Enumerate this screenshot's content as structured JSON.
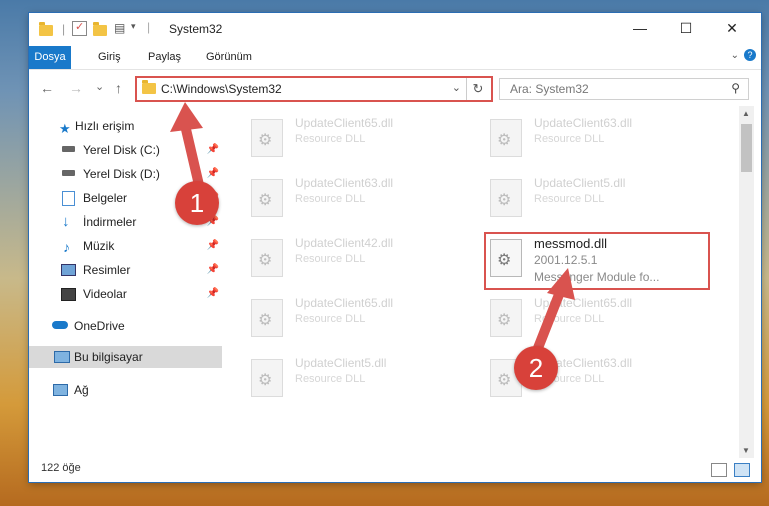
{
  "window": {
    "title": "System32",
    "minimize": "—",
    "maximize": "☐",
    "close": "✕"
  },
  "ribbon": {
    "tabs": [
      "Dosya",
      "Giriş",
      "Paylaş",
      "Görünüm"
    ]
  },
  "address": {
    "path": "C:\\Windows\\System32",
    "dropdown": "⌄",
    "refresh": "↻"
  },
  "search": {
    "placeholder": "Ara: System32",
    "icon": "search-icon"
  },
  "nav": {
    "back": "←",
    "forward": "→",
    "recent": "⌄",
    "up": "↑"
  },
  "sidebar": {
    "items": [
      {
        "label": "Hızlı erişim",
        "icon": "star-icon",
        "pinned": false
      },
      {
        "label": "Yerel Disk (C:)",
        "icon": "drive-icon",
        "pinned": true
      },
      {
        "label": "Yerel Disk (D:)",
        "icon": "drive-icon",
        "pinned": true
      },
      {
        "label": "Belgeler",
        "icon": "documents-icon",
        "pinned": true
      },
      {
        "label": "İndirmeler",
        "icon": "download-icon",
        "pinned": true
      },
      {
        "label": "Müzik",
        "icon": "music-icon",
        "pinned": true
      },
      {
        "label": "Resimler",
        "icon": "pictures-icon",
        "pinned": true
      },
      {
        "label": "Videolar",
        "icon": "videos-icon",
        "pinned": true
      },
      {
        "label": "OneDrive",
        "icon": "cloud-icon",
        "pinned": false
      },
      {
        "label": "Bu bilgisayar",
        "icon": "computer-icon",
        "pinned": false
      },
      {
        "label": "Ağ",
        "icon": "network-icon",
        "pinned": false
      }
    ],
    "pin_glyph": "📌"
  },
  "files": [
    {
      "name": "UpdateClient65.dll",
      "desc": "Resource DLL"
    },
    {
      "name": "UpdateClient63.dll",
      "desc": "Resource DLL"
    },
    {
      "name": "UpdateClient63.dll",
      "desc": "Resource DLL"
    },
    {
      "name": "UpdateClient5.dll",
      "desc": "Resource DLL"
    },
    {
      "name": "UpdateClient42.dll",
      "desc": "Resource DLL"
    },
    {
      "name": "messmod.dll",
      "version": "2001.12.5.1",
      "desc": "Messenger Module fo..."
    },
    {
      "name": "UpdateClient65.dll",
      "desc": "Resource DLL"
    },
    {
      "name": "UpdateClient65.dll",
      "desc": "Resource DLL"
    },
    {
      "name": "UpdateClient5.dll",
      "desc": "Resource DLL"
    },
    {
      "name": "UpdateClient63.dll",
      "desc": "Resource DLL"
    }
  ],
  "status": {
    "count": "122 öğe"
  },
  "annotations": {
    "step1": "1",
    "step2": "2",
    "color": "#d9534f"
  }
}
